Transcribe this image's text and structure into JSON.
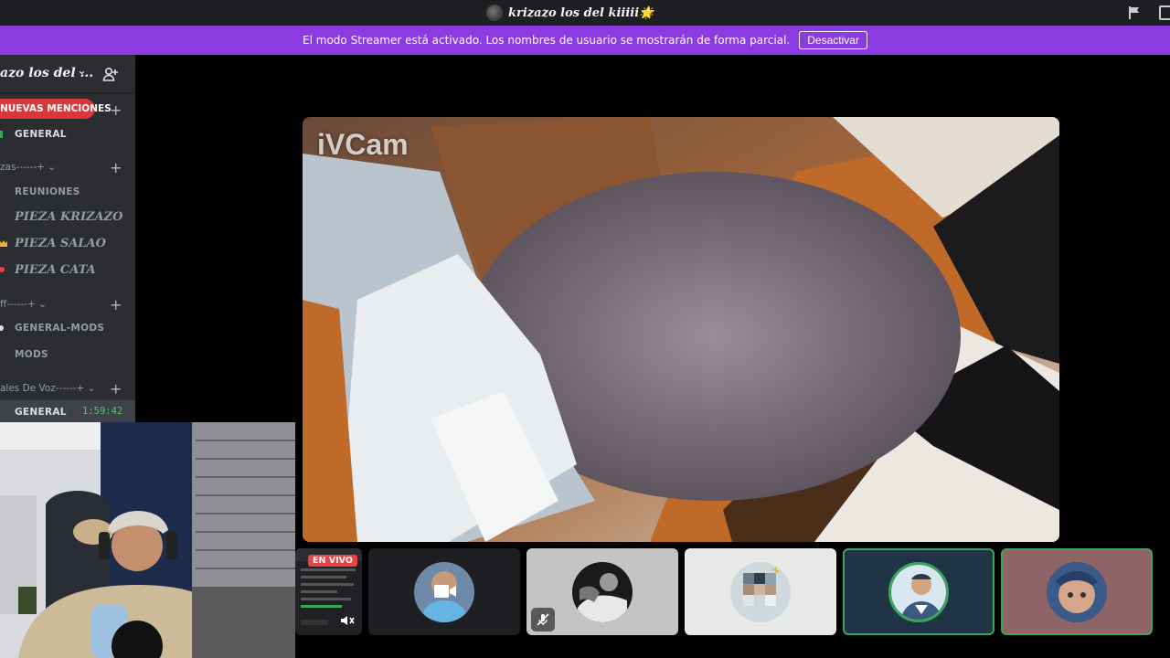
{
  "titlebar": {
    "title": "krizazo los del kiiiii",
    "title_emoji": "🌟"
  },
  "streamer_bar": {
    "message": "El modo Streamer está activado. Los nombres de usuario se mostrarán de forma parcial.",
    "button_label": "Desactivar"
  },
  "sidebar": {
    "server_name": "azo los del ...",
    "mentions_pill": "NUEVAS MENCIONES",
    "categories": {
      "cat1": "zas------+",
      "cat2": "ff------+",
      "cat3": "ales De Voz------+"
    },
    "channels": {
      "general": "GENERAL",
      "reuniones": "REUNIONES",
      "pieza_krizazo": "PIEZA KRIZAZO",
      "pieza_salao": "PIEZA SALAO",
      "pieza_cata": "PIEZA CATA",
      "general_mods": "GENERAL-MODS",
      "mods": "MODS",
      "voice_general": "GENERAL"
    },
    "voice_timer": "1:59:42"
  },
  "stage": {
    "watermark": "iVCam"
  },
  "participants": {
    "live_badge": "EN VIVO"
  },
  "colors": {
    "streamer_purple": "#8b3be0",
    "mention_red": "#da373c",
    "speaking_green": "#3ba55d",
    "timer_green": "#57c26b"
  }
}
